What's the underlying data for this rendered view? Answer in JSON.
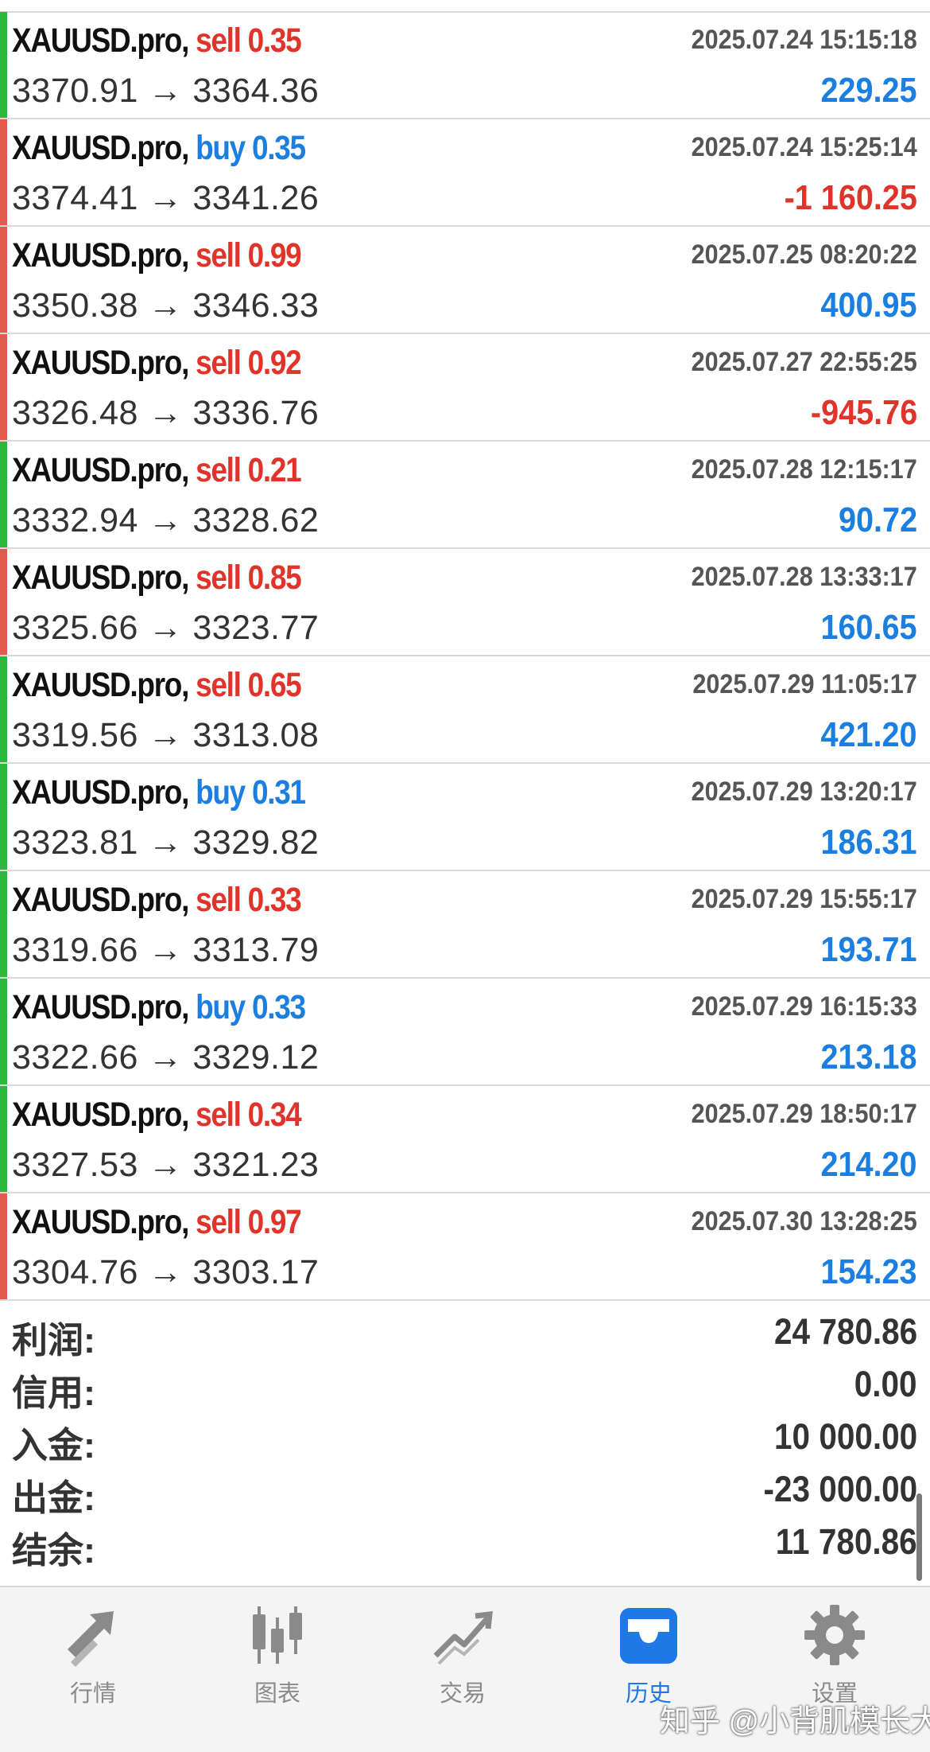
{
  "deals": [
    {
      "symbol": "XAUUSD.pro,",
      "side": "sell",
      "volume": "0.35",
      "open": "3370.91",
      "close": "3364.36",
      "time": "2025.07.24 15:15:18",
      "profit": "229.25",
      "bar": "#2db83d",
      "profit_color": "#1a7fe0"
    },
    {
      "symbol": "XAUUSD.pro,",
      "side": "buy",
      "volume": "0.35",
      "open": "3374.41",
      "close": "3341.26",
      "time": "2025.07.24 15:25:14",
      "profit": "-1 160.25",
      "bar": "#e05a4e",
      "profit_color": "#e0342a"
    },
    {
      "symbol": "XAUUSD.pro,",
      "side": "sell",
      "volume": "0.99",
      "open": "3350.38",
      "close": "3346.33",
      "time": "2025.07.25 08:20:22",
      "profit": "400.95",
      "bar": "#e05a4e",
      "profit_color": "#1a7fe0"
    },
    {
      "symbol": "XAUUSD.pro,",
      "side": "sell",
      "volume": "0.92",
      "open": "3326.48",
      "close": "3336.76",
      "time": "2025.07.27 22:55:25",
      "profit": "-945.76",
      "bar": "#e05a4e",
      "profit_color": "#e0342a"
    },
    {
      "symbol": "XAUUSD.pro,",
      "side": "sell",
      "volume": "0.21",
      "open": "3332.94",
      "close": "3328.62",
      "time": "2025.07.28 12:15:17",
      "profit": "90.72",
      "bar": "#2db83d",
      "profit_color": "#1a7fe0"
    },
    {
      "symbol": "XAUUSD.pro,",
      "side": "sell",
      "volume": "0.85",
      "open": "3325.66",
      "close": "3323.77",
      "time": "2025.07.28 13:33:17",
      "profit": "160.65",
      "bar": "#e05a4e",
      "profit_color": "#1a7fe0"
    },
    {
      "symbol": "XAUUSD.pro,",
      "side": "sell",
      "volume": "0.65",
      "open": "3319.56",
      "close": "3313.08",
      "time": "2025.07.29 11:05:17",
      "profit": "421.20",
      "bar": "#2db83d",
      "profit_color": "#1a7fe0"
    },
    {
      "symbol": "XAUUSD.pro,",
      "side": "buy",
      "volume": "0.31",
      "open": "3323.81",
      "close": "3329.82",
      "time": "2025.07.29 13:20:17",
      "profit": "186.31",
      "bar": "#2db83d",
      "profit_color": "#1a7fe0"
    },
    {
      "symbol": "XAUUSD.pro,",
      "side": "sell",
      "volume": "0.33",
      "open": "3319.66",
      "close": "3313.79",
      "time": "2025.07.29 15:55:17",
      "profit": "193.71",
      "bar": "#2db83d",
      "profit_color": "#1a7fe0"
    },
    {
      "symbol": "XAUUSD.pro,",
      "side": "buy",
      "volume": "0.33",
      "open": "3322.66",
      "close": "3329.12",
      "time": "2025.07.29 16:15:33",
      "profit": "213.18",
      "bar": "#2db83d",
      "profit_color": "#1a7fe0"
    },
    {
      "symbol": "XAUUSD.pro,",
      "side": "sell",
      "volume": "0.34",
      "open": "3327.53",
      "close": "3321.23",
      "time": "2025.07.29 18:50:17",
      "profit": "214.20",
      "bar": "#2db83d",
      "profit_color": "#1a7fe0"
    },
    {
      "symbol": "XAUUSD.pro,",
      "side": "sell",
      "volume": "0.97",
      "open": "3304.76",
      "close": "3303.17",
      "time": "2025.07.30 13:28:25",
      "profit": "154.23",
      "bar": "#e05a4e",
      "profit_color": "#1a7fe0"
    }
  ],
  "side_colors": {
    "sell": "#e0342a",
    "buy": "#1a7fe0"
  },
  "arrow": "→",
  "summary": [
    {
      "label": "利润:",
      "value": "24 780.86"
    },
    {
      "label": "信用:",
      "value": "0.00"
    },
    {
      "label": "入金:",
      "value": "10 000.00"
    },
    {
      "label": "出金:",
      "value": "-23 000.00"
    },
    {
      "label": "结余:",
      "value": "11 780.86"
    }
  ],
  "tabs": [
    {
      "id": "quotes",
      "label": "行情",
      "icon": "quotes-arrows-icon",
      "active": false
    },
    {
      "id": "chart",
      "label": "图表",
      "icon": "candlestick-icon",
      "active": false
    },
    {
      "id": "trade",
      "label": "交易",
      "icon": "trade-line-icon",
      "active": false
    },
    {
      "id": "history",
      "label": "历史",
      "icon": "inbox-tray-icon",
      "active": true
    },
    {
      "id": "settings",
      "label": "设置",
      "icon": "gear-icon",
      "active": false
    }
  ],
  "colors": {
    "active_tab": "#1e78e6",
    "inactive_tab": "#8a8a8a"
  },
  "watermark": "知乎 @小背肌模长大"
}
